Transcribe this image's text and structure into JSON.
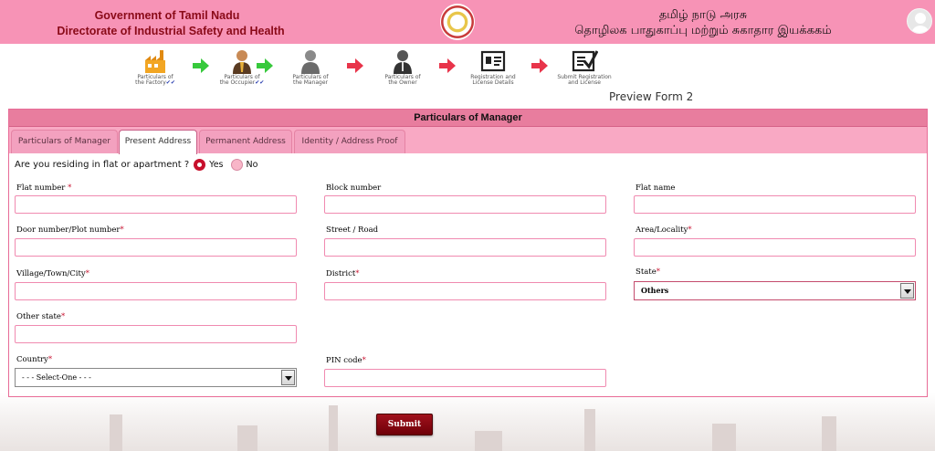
{
  "header": {
    "org_en_line1": "Government of Tamil Nadu",
    "org_en_line2": "Directorate of Industrial Safety and Health",
    "org_ta_line1": "தமிழ் நாடு அரசு",
    "org_ta_line2": "தொழிலக பாதுகாப்பு மற்றும் சுகாதார இயக்ககம்"
  },
  "steps": [
    {
      "line1": "Particulars of",
      "line2": "the Factory",
      "check": "✔✔",
      "icon": "factory-icon"
    },
    {
      "line1": "Particulars of",
      "line2": "the Occupier",
      "check": "✔✔",
      "icon": "occupier-person-icon"
    },
    {
      "line1": "Particulars of",
      "line2": "the Manager",
      "check": "",
      "icon": "manager-person-icon"
    },
    {
      "line1": "Particulars of",
      "line2": "the Owner",
      "check": "",
      "icon": "owner-person-icon"
    },
    {
      "line1": "Registration and",
      "line2": "License Details",
      "check": "",
      "icon": "id-card-icon"
    },
    {
      "line1": "Submit Registration",
      "line2": "and License",
      "check": "",
      "icon": "checklist-icon"
    }
  ],
  "preview_label": "Preview Form 2",
  "panel": {
    "title": "Particulars of Manager",
    "tabs": [
      "Particulars of Manager",
      "Present Address",
      "Permanent Address",
      "Identity / Address Proof"
    ],
    "active_tab": "Present Address"
  },
  "residing": {
    "question": "Are you residing in flat or apartment ?",
    "yes": "Yes",
    "no": "No",
    "selected": "Yes"
  },
  "fields": {
    "flat_number": {
      "label": "Flat number",
      "required": "*",
      "value": ""
    },
    "block_number": {
      "label": "Block number",
      "value": ""
    },
    "flat_name": {
      "label": "Flat name",
      "value": ""
    },
    "door_number": {
      "label": "Door number/Plot number",
      "required": "*",
      "value": ""
    },
    "street": {
      "label": "Street / Road",
      "value": ""
    },
    "area": {
      "label": "Area/Locality",
      "required": "*",
      "value": ""
    },
    "village": {
      "label": "Village/Town/City",
      "required": "*",
      "value": ""
    },
    "district": {
      "label": "District",
      "required": "*",
      "value": ""
    },
    "state": {
      "label": "State",
      "required": "*",
      "selected": "Others"
    },
    "other_state": {
      "label": "Other state",
      "required": "*",
      "value": ""
    },
    "country": {
      "label": "Country",
      "required": "*",
      "selected": "- - - Select-One - - -"
    },
    "pin_code": {
      "label": "PIN code",
      "required": "*",
      "value": ""
    }
  },
  "submit_label": "Submit",
  "colors": {
    "header_bg": "#f793b6",
    "accent": "#c8102e",
    "tab_bg": "#f9a9c4",
    "button": "#8b0a14"
  }
}
